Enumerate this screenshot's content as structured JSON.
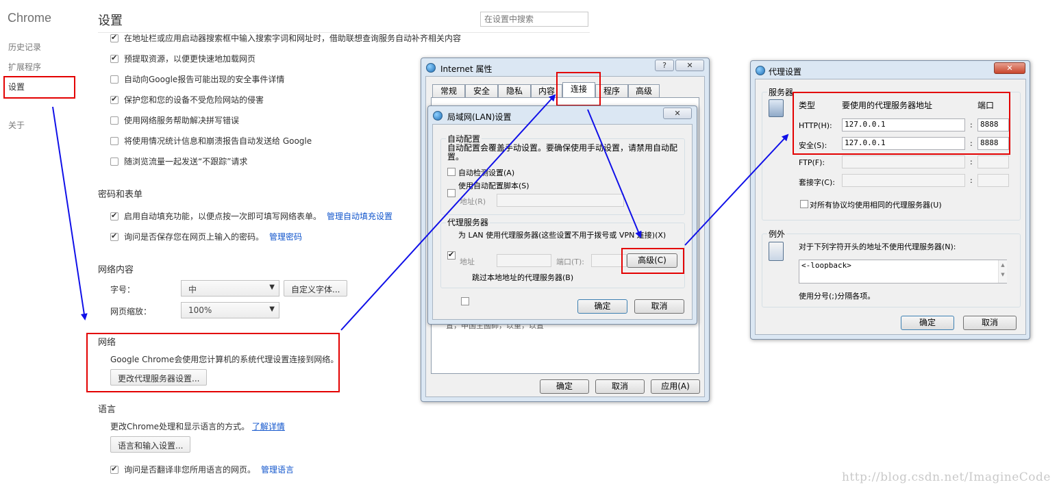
{
  "chrome": {
    "brand": "Chrome",
    "sidebar": [
      "历史记录",
      "扩展程序",
      "设置",
      "关于"
    ],
    "title": "设置",
    "search_placeholder": "在设置中搜索",
    "privacy_items": [
      {
        "label": "在地址栏或应用启动器搜索框中输入搜索字词和网址时，借助联想查询服务自动补齐相关内容",
        "checked": true
      },
      {
        "label": "预提取资源，以便更快速地加载网页",
        "checked": true
      },
      {
        "label": "自动向Google报告可能出现的安全事件详情",
        "checked": false
      },
      {
        "label": "保护您和您的设备不受危险网站的侵害",
        "checked": true
      },
      {
        "label": "使用网络服务帮助解决拼写错误",
        "checked": false
      },
      {
        "label": "将使用情况统计信息和崩溃报告自动发送给 Google",
        "checked": false
      },
      {
        "label": "随浏览流量一起发送“不跟踪”请求",
        "checked": false
      }
    ],
    "passwords": {
      "title": "密码和表单",
      "autofill": "启用自动填充功能，以便点按一次即可填写网络表单。",
      "autofill_link": "管理自动填充设置",
      "save_pw": "询问是否保存您在网页上输入的密码。",
      "save_pw_link": "管理密码"
    },
    "web_content": {
      "title": "网络内容",
      "font_size_label": "字号：",
      "font_size_value": "中",
      "custom_fonts": "自定义字体...",
      "zoom_label": "网页缩放：",
      "zoom_value": "100%"
    },
    "network": {
      "title": "网络",
      "desc": "Google Chrome会使用您计算机的系统代理设置连接到网络。",
      "button": "更改代理服务器设置..."
    },
    "language": {
      "title": "语言",
      "desc": "更改Chrome处理和显示语言的方式。",
      "link": "了解详情",
      "button": "语言和输入设置...",
      "translate": "询问是否翻译非您所用语言的网页。",
      "translate_link": "管理语言"
    }
  },
  "inet": {
    "title": "Internet 属性",
    "help": "?",
    "tabs": [
      "常规",
      "安全",
      "隐私",
      "内容",
      "连接",
      "程序",
      "高级"
    ],
    "behind_text": "置，申国主國師，以重，以置",
    "ok": "确定",
    "cancel": "取消",
    "apply": "应用(A)"
  },
  "lan": {
    "title": "局域网(LAN)设置",
    "auto_group": "自动配置",
    "auto_desc": "自动配置会覆盖手动设置。要确保使用手动设置，请禁用自动配置。",
    "auto_detect": "自动检测设置(A)",
    "auto_script": "使用自动配置脚本(S)",
    "addr_label": "地址(R)",
    "proxy_group": "代理服务器",
    "use_proxy": "为 LAN 使用代理服务器(这些设置不用于拨号或 VPN 连接)(X)",
    "addr2_label": "地址",
    "port_label": "端口(T):",
    "advanced": "高级(C)",
    "bypass_local": "跳过本地地址的代理服务器(B)",
    "ok": "确定",
    "cancel": "取消"
  },
  "proxy": {
    "title": "代理设置",
    "servers_group": "服务器",
    "col_type": "类型",
    "col_addr": "要使用的代理服务器地址",
    "col_port": "端口",
    "rows": [
      {
        "type": "HTTP(H):",
        "addr": "127.0.0.1",
        "port": "8888"
      },
      {
        "type": "安全(S):",
        "addr": "127.0.0.1",
        "port": "8888"
      },
      {
        "type": "FTP(F):",
        "addr": "",
        "port": ""
      },
      {
        "type": "套接字(C):",
        "addr": "",
        "port": ""
      }
    ],
    "same_proxy": "对所有协议均使用相同的代理服务器(U)",
    "exceptions_group": "例外",
    "exceptions_desc": "对于下列字符开头的地址不使用代理服务器(N):",
    "exceptions_value": "<-loopback>",
    "exceptions_hint": "使用分号(;)分隔各项。",
    "ok": "确定",
    "cancel": "取消"
  },
  "watermark": "http://blog.csdn.net/ImagineCode",
  "colors": {
    "annotation_red": "#e30000",
    "arrow_blue": "#1010e8",
    "link_blue": "#1155cc"
  }
}
